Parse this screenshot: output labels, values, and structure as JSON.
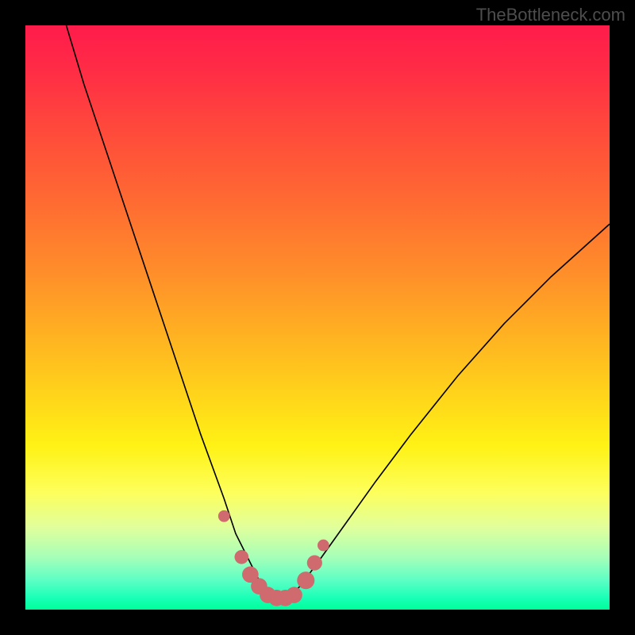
{
  "watermark": "TheBottleneck.com",
  "colors": {
    "background": "#000000",
    "curve": "#000000",
    "markers": "#cf6a6e",
    "gradient_top": "#ff1b4b",
    "gradient_bottom": "#00ff9a"
  },
  "chart_data": {
    "type": "line",
    "title": "",
    "xlabel": "",
    "ylabel": "",
    "xlim": [
      0,
      100
    ],
    "ylim": [
      0,
      100
    ],
    "series": [
      {
        "name": "bottleneck-curve",
        "x": [
          7,
          10,
          14,
          18,
          22,
          26,
          30,
          34,
          36,
          38,
          40,
          42,
          43,
          44,
          45,
          47,
          50,
          55,
          60,
          66,
          74,
          82,
          90,
          100
        ],
        "y": [
          100,
          90,
          78,
          66,
          54,
          42,
          30,
          19,
          13,
          9,
          5,
          3,
          2,
          1.5,
          2,
          4,
          8,
          15,
          22,
          30,
          40,
          49,
          57,
          66
        ]
      }
    ],
    "markers": {
      "name": "highlight-points",
      "x": [
        34,
        37,
        38.5,
        40,
        41.5,
        43,
        44.5,
        46,
        48,
        49.5,
        51
      ],
      "y": [
        16,
        9,
        6,
        4,
        2.5,
        2,
        2,
        2.5,
        5,
        8,
        11
      ],
      "r": [
        1.0,
        1.2,
        1.4,
        1.4,
        1.4,
        1.4,
        1.4,
        1.4,
        1.5,
        1.3,
        1.0
      ]
    }
  }
}
